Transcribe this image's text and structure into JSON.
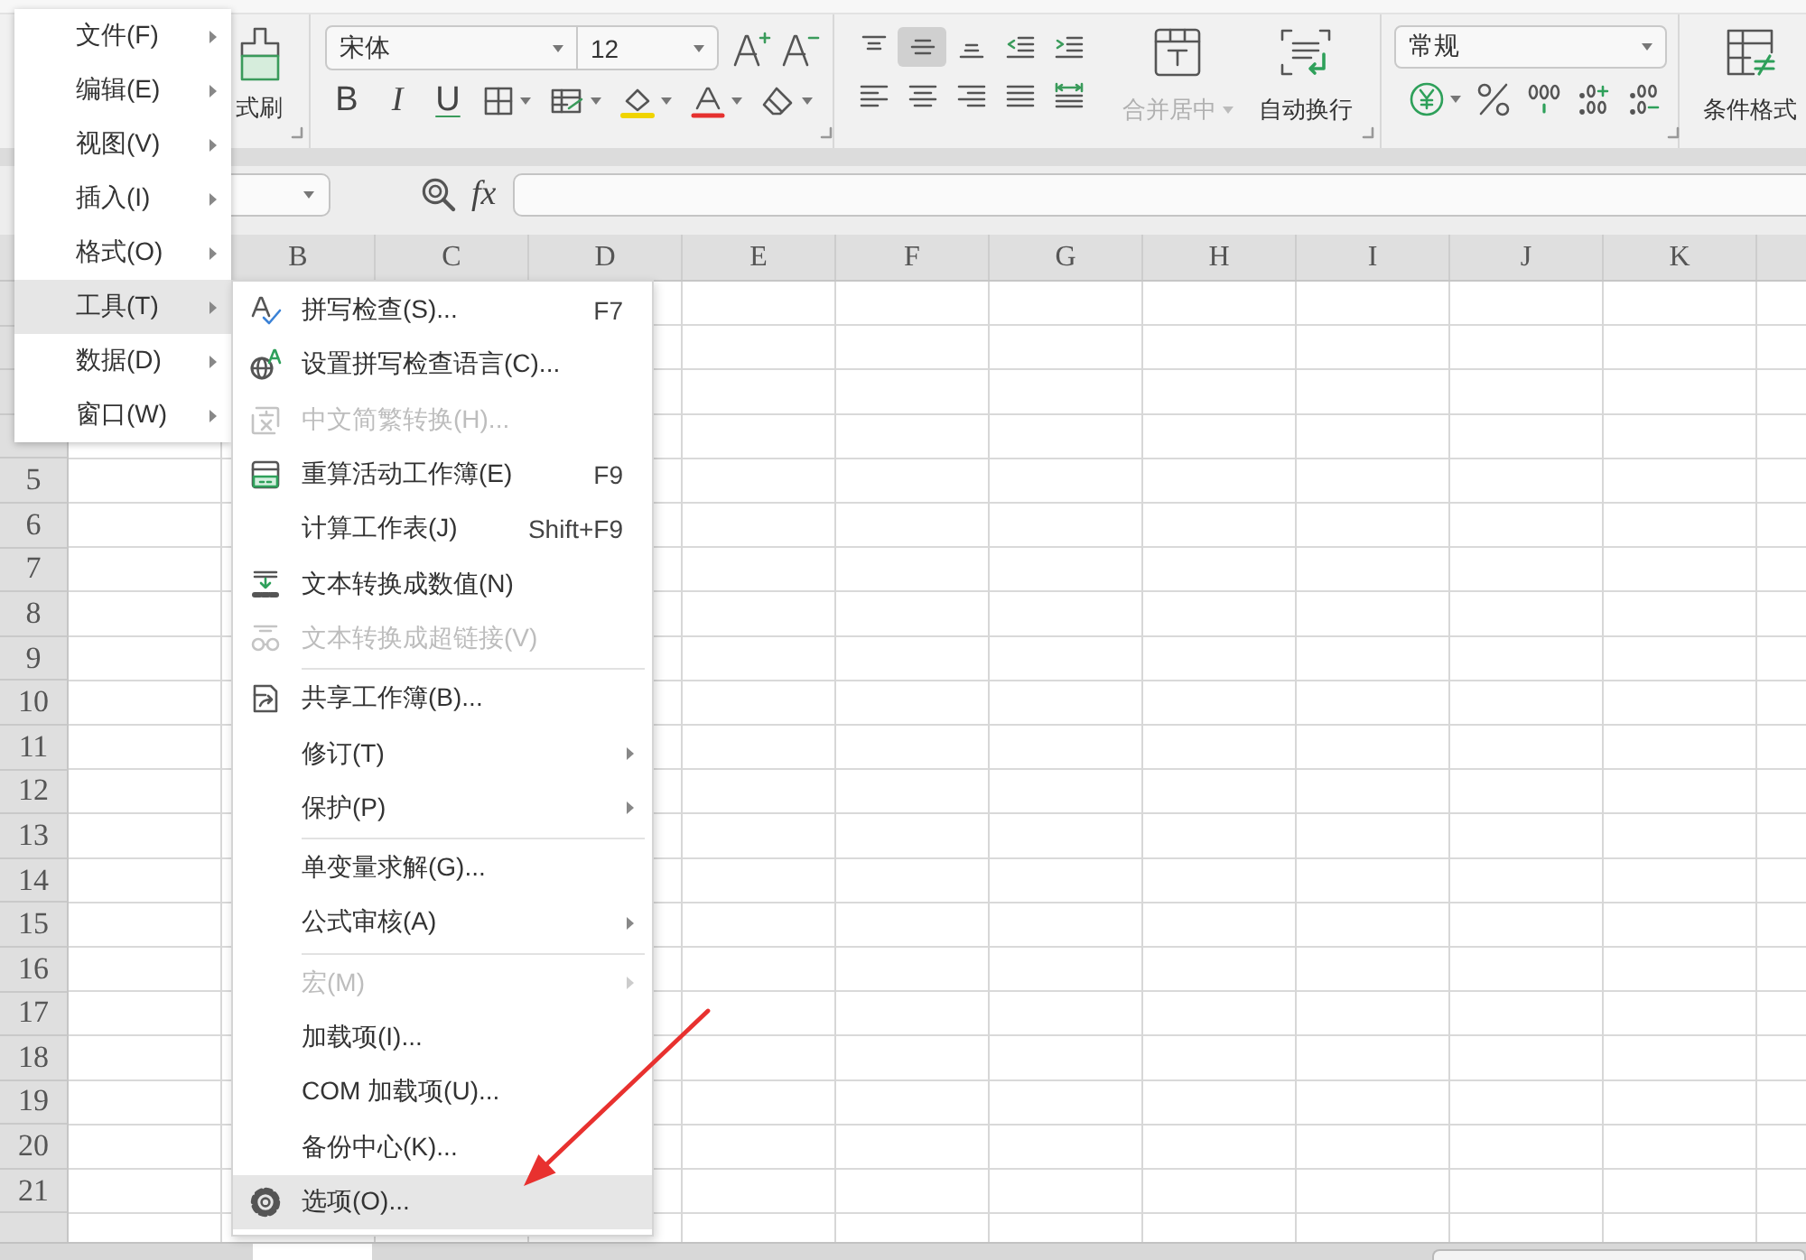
{
  "ribbon": {
    "format_painter": {
      "label": "式刷"
    },
    "font": {
      "name": "宋体",
      "size": "12"
    },
    "style_buttons": [
      {
        "label": "B",
        "kind": "bold"
      },
      {
        "label": "I",
        "kind": "italic"
      },
      {
        "label": "U",
        "kind": "underline"
      }
    ],
    "alignment": [
      {
        "selected": false
      },
      {
        "selected": true
      },
      {
        "selected": false
      },
      {
        "selected": false
      },
      {
        "selected": false
      },
      {
        "selected": false
      },
      {
        "selected": false
      },
      {
        "selected": false
      },
      {
        "selected": false
      },
      {
        "selected": false
      }
    ],
    "merge_center": {
      "label": "合并居中",
      "disabled": true
    },
    "wrap_text": {
      "label": "自动换行",
      "disabled": false
    },
    "number_format": {
      "value": "常规"
    },
    "conditional_format": {
      "label": "条件格式"
    }
  },
  "formula_bar": {
    "fx_label": "fx"
  },
  "sheet": {
    "columns": [
      "B",
      "C",
      "D",
      "E",
      "F",
      "G",
      "H",
      "I",
      "J",
      "K"
    ],
    "rows": [
      "5",
      "6",
      "7",
      "8",
      "9",
      "10",
      "11",
      "12",
      "13",
      "14",
      "15",
      "16",
      "17",
      "18",
      "19",
      "20",
      "21"
    ]
  },
  "main_menu": {
    "items": [
      {
        "label": "文件(F)",
        "selected": false,
        "has_submenu": true
      },
      {
        "label": "编辑(E)",
        "selected": false,
        "has_submenu": true
      },
      {
        "label": "视图(V)",
        "selected": false,
        "has_submenu": true
      },
      {
        "label": "插入(I)",
        "selected": false,
        "has_submenu": true
      },
      {
        "label": "格式(O)",
        "selected": false,
        "has_submenu": true
      },
      {
        "label": "工具(T)",
        "selected": true,
        "has_submenu": true
      },
      {
        "label": "数据(D)",
        "selected": false,
        "has_submenu": true
      },
      {
        "label": "窗口(W)",
        "selected": false,
        "has_submenu": true
      }
    ]
  },
  "tools_menu": {
    "sections": [
      {
        "items": [
          {
            "label": "拼写检查(S)...",
            "shortcut": "F7",
            "disabled": false,
            "selected": false,
            "has_submenu": false
          },
          {
            "label": "设置拼写检查语言(C)...",
            "disabled": false,
            "selected": false,
            "has_submenu": false
          },
          {
            "label": "中文简繁转换(H)...",
            "disabled": true,
            "selected": false,
            "has_submenu": false
          },
          {
            "label": "重算活动工作簿(E)",
            "shortcut": "F9",
            "disabled": false,
            "selected": false,
            "has_submenu": false
          },
          {
            "label": "计算工作表(J)",
            "shortcut": "Shift+F9",
            "disabled": false,
            "selected": false,
            "has_submenu": false
          },
          {
            "label": "文本转换成数值(N)",
            "disabled": false,
            "selected": false,
            "has_submenu": false
          },
          {
            "label": "文本转换成超链接(V)",
            "disabled": true,
            "selected": false,
            "has_submenu": false
          }
        ]
      },
      {
        "items": [
          {
            "label": "共享工作簿(B)...",
            "disabled": false,
            "selected": false,
            "has_submenu": false
          },
          {
            "label": "修订(T)",
            "disabled": false,
            "selected": false,
            "has_submenu": true
          },
          {
            "label": "保护(P)",
            "disabled": false,
            "selected": false,
            "has_submenu": true
          }
        ]
      },
      {
        "items": [
          {
            "label": "单变量求解(G)...",
            "disabled": false,
            "selected": false,
            "has_submenu": false
          },
          {
            "label": "公式审核(A)",
            "disabled": false,
            "selected": false,
            "has_submenu": true
          }
        ]
      },
      {
        "items": [
          {
            "label": "宏(M)",
            "disabled": true,
            "selected": false,
            "has_submenu": true
          },
          {
            "label": "加载项(I)...",
            "disabled": false,
            "selected": false,
            "has_submenu": false
          },
          {
            "label": "COM 加载项(U)...",
            "disabled": false,
            "selected": false,
            "has_submenu": false
          },
          {
            "label": "备份中心(K)...",
            "disabled": false,
            "selected": false,
            "has_submenu": false
          },
          {
            "label": "选项(O)...",
            "disabled": false,
            "selected": true,
            "has_submenu": false
          }
        ]
      }
    ]
  }
}
